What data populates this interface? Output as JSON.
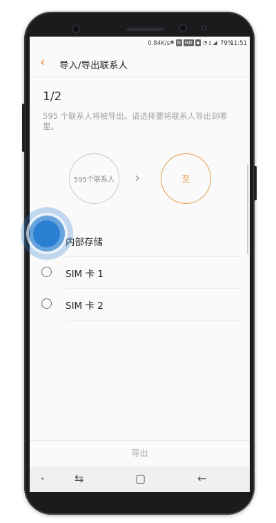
{
  "status_bar": {
    "network_speed": "0.84K/s",
    "icons": [
      "bluetooth-icon",
      "nfc-icon",
      "hd-icon",
      "sim-icon",
      "wifi-icon",
      "vibrate-icon",
      "signal-icon"
    ],
    "battery": "79%",
    "time": "11:51",
    "hd_label": "HD"
  },
  "app_bar": {
    "back_icon": "chevron-left-icon",
    "title": "导入/导出联系人"
  },
  "content": {
    "step": "1/2",
    "description": "595 个联系人将被导出。请选择要将联系人导出到哪里。",
    "source_label": "595个联系人",
    "arrow": "›",
    "target_label": "至"
  },
  "options": [
    {
      "label": "内部存储",
      "selected": false
    },
    {
      "label": "SIM 卡 1",
      "selected": false
    },
    {
      "label": "SIM 卡 2",
      "selected": false
    }
  ],
  "footer": {
    "export_label": "导出"
  },
  "nav": {
    "dot": "•",
    "recents": "⇆",
    "home": "▢",
    "back": "←"
  },
  "colors": {
    "accent": "#e4822b",
    "touch": "#2a7fd2"
  }
}
